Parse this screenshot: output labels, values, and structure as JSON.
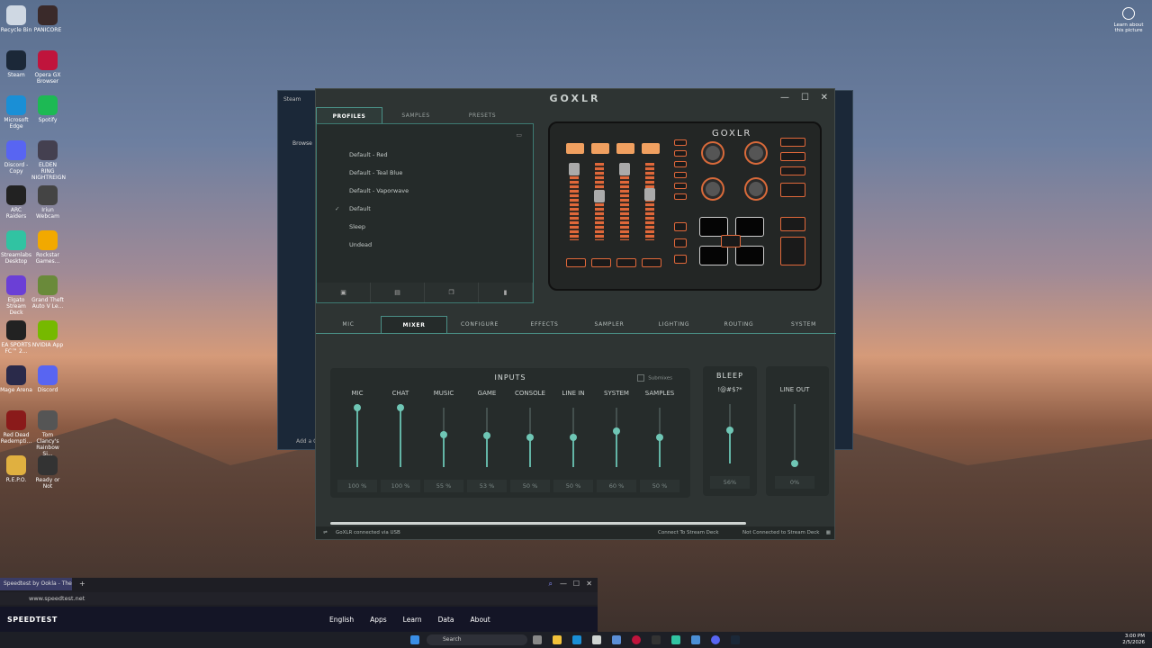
{
  "desktop": {
    "icons": [
      {
        "label": "Recycle Bin",
        "color": "#cfd8e3"
      },
      {
        "label": "PANICORE",
        "color": "#3a2a2a"
      },
      {
        "label": "Steam",
        "color": "#1b2838"
      },
      {
        "label": "Opera GX Browser",
        "color": "#c0143c"
      },
      {
        "label": "Microsoft Edge",
        "color": "#1a8fd6"
      },
      {
        "label": "Spotify",
        "color": "#1db954"
      },
      {
        "label": "Discord - Copy",
        "color": "#5865f2"
      },
      {
        "label": "ELDEN RING NIGHTREIGN",
        "color": "#444050"
      },
      {
        "label": "ARC Raiders",
        "color": "#222"
      },
      {
        "label": "Iriun Webcam",
        "color": "#444"
      },
      {
        "label": "Streamlabs Desktop",
        "color": "#31c3a2"
      },
      {
        "label": "Rockstar Games...",
        "color": "#f2a900"
      },
      {
        "label": "Elgato Stream Deck",
        "color": "#6b3fd6"
      },
      {
        "label": "Grand Theft Auto V Le...",
        "color": "#6a8a3a"
      },
      {
        "label": "EA SPORTS FC™ 2...",
        "color": "#222"
      },
      {
        "label": "NVIDIA App",
        "color": "#76b900"
      },
      {
        "label": "Mage Arena",
        "color": "#2a2a4a"
      },
      {
        "label": "Discord",
        "color": "#5865f2"
      },
      {
        "label": "Red Dead Redempti...",
        "color": "#8a1a1a"
      },
      {
        "label": "Tom Clancy's Rainbow Si...",
        "color": "#555"
      },
      {
        "label": "R.E.P.O.",
        "color": "#e0b040"
      },
      {
        "label": "Ready or Not",
        "color": "#333"
      }
    ],
    "learn_label": "Learn about this picture"
  },
  "steam_window": {
    "title": "Steam",
    "browse": "Browse",
    "add": "Add a G"
  },
  "goxlr": {
    "logo": "GOXLR",
    "device_logo": "GOXLR",
    "profile_tabs": [
      "PROFILES",
      "SAMPLES",
      "PRESETS"
    ],
    "profiles": [
      "Default - Red",
      "Default - Teal Blue",
      "Default - Vaporwave",
      "Default",
      "Sleep",
      "Undead"
    ],
    "active_profile": "Default",
    "main_tabs": [
      "MIC",
      "MIXER",
      "CONFIGURE",
      "EFFECTS",
      "SAMPLER",
      "LIGHTING",
      "ROUTING",
      "SYSTEM"
    ],
    "inputs_title": "INPUTS",
    "submixes_label": "Submixes",
    "channels": [
      {
        "name": "MIC",
        "value": "100 %",
        "level": 1.0
      },
      {
        "name": "CHAT",
        "value": "100 %",
        "level": 1.0
      },
      {
        "name": "MUSIC",
        "value": "55 %",
        "level": 0.55
      },
      {
        "name": "GAME",
        "value": "53 %",
        "level": 0.53
      },
      {
        "name": "CONSOLE",
        "value": "50 %",
        "level": 0.5
      },
      {
        "name": "LINE IN",
        "value": "50 %",
        "level": 0.5
      },
      {
        "name": "SYSTEM",
        "value": "60 %",
        "level": 0.6
      },
      {
        "name": "SAMPLES",
        "value": "50 %",
        "level": 0.5
      }
    ],
    "bleep": {
      "title": "BLEEP",
      "label": "!@#$?*",
      "value": "56%",
      "level": 0.56
    },
    "lineout": {
      "title": "LINE OUT",
      "value": "0%",
      "level": 0.0
    },
    "status_left": "GoXLR connected via USB",
    "status_mid": "Connect To Stream Deck",
    "status_right": "Not Connected to Stream Deck",
    "accent": "#63b5a6",
    "orange": "#e0683a"
  },
  "browser": {
    "tab": "Speedtest by Ookla - The",
    "url": "www.speedtest.net",
    "logo": "SPEEDTEST",
    "nav": [
      "English",
      "Apps",
      "Learn",
      "Data",
      "About"
    ]
  },
  "taskbar": {
    "search": "Search",
    "time": "3:00 PM",
    "date": "2/5/2026"
  }
}
